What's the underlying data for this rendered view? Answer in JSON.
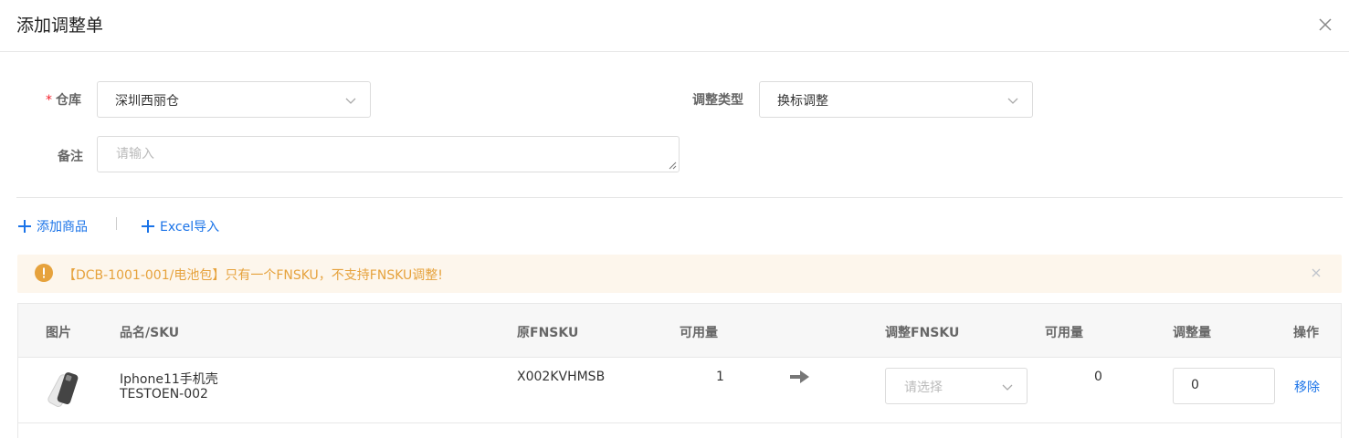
{
  "dialog": {
    "title": "添加调整单"
  },
  "form": {
    "warehouse_label": "仓库",
    "warehouse_value": "深圳西丽仓",
    "type_label": "调整类型",
    "type_value": "换标调整",
    "remark_label": "备注",
    "remark_placeholder": "请输入"
  },
  "actions": {
    "add_product": "添加商品",
    "excel_import": "Excel导入"
  },
  "alert": {
    "message": "【DCB-1001-001/电池包】只有一个FNSKU，不支持FNSKU调整!"
  },
  "table": {
    "headers": {
      "image": "图片",
      "name_sku": "品名/SKU",
      "orig_fnsku": "原FNSKU",
      "available": "可用量",
      "adjust_fnsku": "调整FNSKU",
      "available2": "可用量",
      "adjust_qty": "调整量",
      "operation": "操作"
    },
    "rows": [
      {
        "name": "Iphone11手机壳",
        "sku": "TESTOEN-002",
        "orig_fnsku": "X002KVHMSB",
        "available": "1",
        "adjust_fnsku_placeholder": "请选择",
        "available2": "0",
        "adjust_qty": "0",
        "remove": "移除"
      }
    ]
  },
  "colors": {
    "accent": "#1a73e8",
    "warning": "#e6a23c",
    "required": "#f5222d"
  },
  "icons": [
    "close-icon",
    "chevron-down-icon",
    "plus-icon",
    "warning-icon",
    "arrow-right-icon",
    "phone-case-thumbnail"
  ]
}
